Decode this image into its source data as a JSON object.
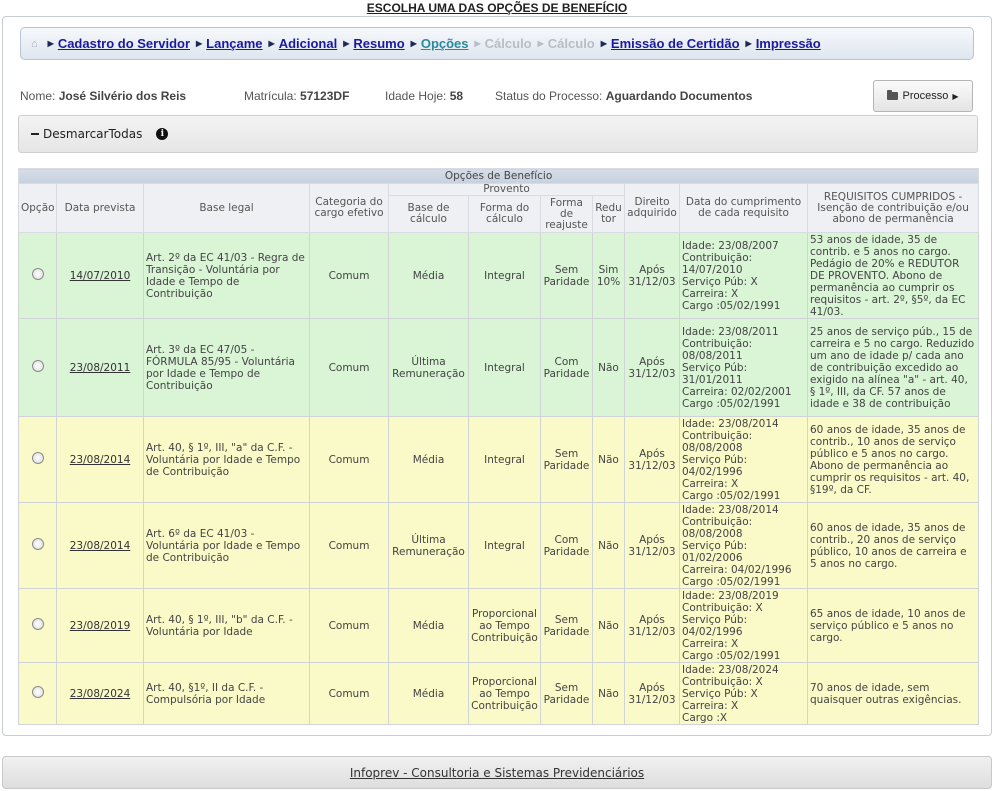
{
  "page_title": "ESCOLHA UMA DAS OPÇÕES DE BENEFÍCIO",
  "breadcrumb": {
    "home_icon": "home-icon",
    "items": [
      {
        "label": "Cadastro do Servidor",
        "state": "link"
      },
      {
        "label": "Lançame",
        "state": "link"
      },
      {
        "label": "Adicional",
        "state": "link"
      },
      {
        "label": "Resumo",
        "state": "link"
      },
      {
        "label": "Opções",
        "state": "active"
      },
      {
        "label": "Cálculo",
        "state": "disabled"
      },
      {
        "label": "Cálculo",
        "state": "disabled"
      },
      {
        "label": "Emissão de Certidão",
        "state": "link"
      },
      {
        "label": "Impressão",
        "state": "link"
      }
    ]
  },
  "info": {
    "nome_label": "Nome:",
    "nome_value": "José Silvério dos Reis",
    "matricula_label": "Matrícula:",
    "matricula_value": "57123DF",
    "idade_label": "Idade Hoje:",
    "idade_value": "58",
    "status_label": "Status do Processo:",
    "status_value": "Aguardando Documentos"
  },
  "processo_button": {
    "label": "Processo",
    "icon": "folder-open-icon"
  },
  "desmarcar": {
    "label": "DesmarcarTodas",
    "icon": "info-icon"
  },
  "table": {
    "caption": "Opções de Benefício",
    "headers": {
      "opcao": "Opção",
      "data_prevista": "Data prevista",
      "base_legal": "Base legal",
      "categoria": "Categoria do cargo efetivo",
      "provento": "Provento",
      "base_calculo": "Base de cálculo",
      "forma_calculo": "Forma do cálculo",
      "forma_reajuste": "Forma de reajuste",
      "redutor": "Redu tor",
      "direito": "Direito adquirido",
      "data_cumprimento": "Data do cumprimento de cada requisito",
      "requisitos": "REQUISITOS CUMPRIDOS - Isenção de contribuição e/ou abono de permanência"
    },
    "rows": [
      {
        "color": "green",
        "date": "14/07/2010",
        "base_legal": "Art. 2º da EC 41/03 - Regra de Transição - Voluntária por Idade e Tempo de Contribuição",
        "categoria": "Comum",
        "base_calculo": "Média",
        "forma_calculo": "Integral",
        "forma_reajuste": "Sem Paridade",
        "redutor": "Sim 10%",
        "direito": "Após 31/12/03",
        "cumprimento": [
          "Idade: 23/08/2007",
          "Contribuição: 14/07/2010",
          "Serviço Púb: X",
          "Carreira: X",
          "Cargo :05/02/1991"
        ],
        "requisitos": "53 anos de idade, 35 de contrib. e 5 anos no cargo. Pedágio de 20% e REDUTOR DE PROVENTO. Abono de permanência ao cumprir os requisitos - art. 2º, §5º, da EC 41/03."
      },
      {
        "color": "green",
        "date": "23/08/2011",
        "base_legal": "Art. 3º da EC 47/05 - FÓRMULA 85/95 - Voluntária por Idade e Tempo de Contribuição",
        "categoria": "Comum",
        "base_calculo": "Última Remuneração",
        "forma_calculo": "Integral",
        "forma_reajuste": "Com Paridade",
        "redutor": "Não",
        "direito": "Após 31/12/03",
        "cumprimento": [
          "Idade: 23/08/2011",
          "Contribuição: 08/08/2011",
          "Serviço Púb: 31/01/2011",
          "Carreira: 02/02/2001",
          "Cargo :05/02/1991"
        ],
        "requisitos": "25 anos de serviço púb., 15 de carreira e 5 no cargo. Reduzido um ano de idade p/ cada ano de contribuição excedido ao exigido na alínea \"a\" - art. 40, § 1º, III, da CF. 57 anos de idade e 38 de contribuição"
      },
      {
        "color": "yellow",
        "date": "23/08/2014",
        "base_legal": "Art. 40, § 1º, III, \"a\" da C.F. - Voluntária por Idade e Tempo de Contribuição",
        "categoria": "Comum",
        "base_calculo": "Média",
        "forma_calculo": "Integral",
        "forma_reajuste": "Sem Paridade",
        "redutor": "Não",
        "direito": "Após 31/12/03",
        "cumprimento": [
          "Idade: 23/08/2014",
          "Contribuição: 08/08/2008",
          "Serviço Púb: 04/02/1996",
          "Carreira: X",
          "Cargo :05/02/1991"
        ],
        "requisitos": "60 anos de idade, 35 anos de contrib., 10 anos de serviço público e 5 anos no cargo. Abono de permanência ao cumprir os requisitos - art. 40, §19º, da CF."
      },
      {
        "color": "yellow",
        "date": "23/08/2014",
        "base_legal": "Art. 6º da EC 41/03 - Voluntária por Idade e Tempo de Contribuição",
        "categoria": "Comum",
        "base_calculo": "Última Remuneração",
        "forma_calculo": "Integral",
        "forma_reajuste": "Com Paridade",
        "redutor": "Não",
        "direito": "Após 31/12/03",
        "cumprimento": [
          "Idade: 23/08/2014",
          "Contribuição: 08/08/2008",
          "Serviço Púb: 01/02/2006",
          "Carreira: 04/02/1996",
          "Cargo :05/02/1991"
        ],
        "requisitos": "60 anos de idade, 35 anos de contrib., 20 anos de serviço público, 10 anos de carreira e 5 anos no cargo."
      },
      {
        "color": "yellow",
        "date": "23/08/2019",
        "base_legal": "Art. 40, § 1º, III, \"b\" da C.F. - Voluntária por Idade",
        "categoria": "Comum",
        "base_calculo": "Média",
        "forma_calculo": "Proporcional ao Tempo Contribuição",
        "forma_reajuste": "Sem Paridade",
        "redutor": "Não",
        "direito": "Após 31/12/03",
        "cumprimento": [
          "Idade: 23/08/2019",
          "Contribuição: X",
          "Serviço Púb: 04/02/1996",
          "Carreira: X",
          "Cargo :05/02/1991"
        ],
        "requisitos": "65 anos de idade, 10 anos de serviço público e 5 anos no cargo."
      },
      {
        "color": "yellow",
        "date": "23/08/2024",
        "base_legal": "Art. 40, §1º, II da C.F. - Compulsória por Idade",
        "categoria": "Comum",
        "base_calculo": "Média",
        "forma_calculo": "Proporcional ao Tempo Contribuição",
        "forma_reajuste": "Sem Paridade",
        "redutor": "Não",
        "direito": "Após 31/12/03",
        "cumprimento": [
          "Idade: 23/08/2024",
          "Contribuição: X",
          "Serviço Púb: X",
          "Carreira: X",
          "Cargo :X"
        ],
        "requisitos": "70 anos de idade, sem quaisquer outras exigências."
      }
    ]
  },
  "footer": {
    "link": "Infoprev - Consultoria e Sistemas Previdenciários"
  }
}
